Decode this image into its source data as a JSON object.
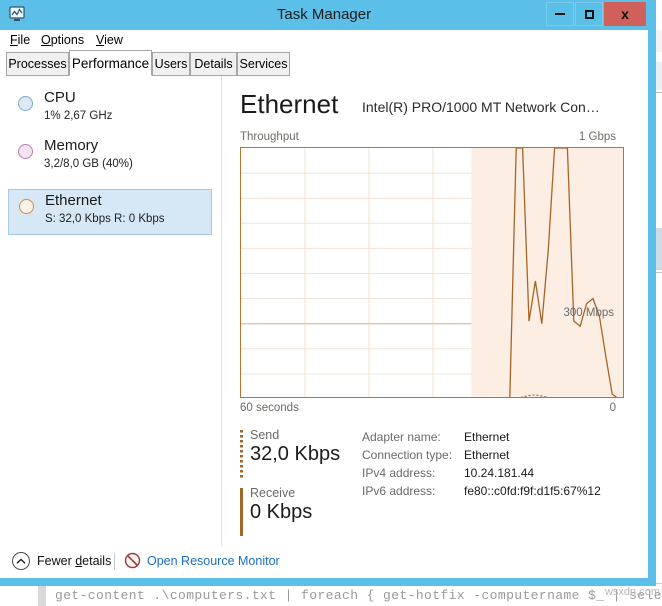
{
  "window": {
    "title": "Task Manager",
    "icon": "task-manager-monitor-icon",
    "controls": {
      "minimize": "–",
      "maximize": "□",
      "close": "x"
    },
    "accent_color": "#5bbfe8",
    "close_color": "#d0605a"
  },
  "menubar": {
    "items": [
      {
        "label": "File",
        "accel": "F"
      },
      {
        "label": "Options",
        "accel": "O"
      },
      {
        "label": "View",
        "accel": "V"
      }
    ]
  },
  "tabs": {
    "active": "Performance",
    "items": [
      {
        "label": "Processes"
      },
      {
        "label": "Performance"
      },
      {
        "label": "Users"
      },
      {
        "label": "Details"
      },
      {
        "label": "Services"
      }
    ]
  },
  "sidebar": {
    "items": [
      {
        "name": "CPU",
        "title": "CPU",
        "subtitle": "1%  2,67 GHz",
        "dot_color": "#dce9f4",
        "dot_border": "#7fa9cd",
        "selected": false
      },
      {
        "name": "Memory",
        "title": "Memory",
        "subtitle": "3,2/8,0 GB (40%)",
        "dot_color": "#f3e2f2",
        "dot_border": "#b57fb2",
        "selected": false
      },
      {
        "name": "Ethernet",
        "title": "Ethernet",
        "subtitle": "S: 32,0 Kbps R: 0 Kbps",
        "dot_color": "#fdf0e4",
        "dot_border": "#c9914c",
        "selected": true
      }
    ]
  },
  "detail": {
    "title": "Ethernet",
    "subtitle": "Intel(R) PRO/1000 MT Network Con…",
    "graph_label_left": "Throughput",
    "graph_label_right": "1 Gbps",
    "graph_mid_label": "300 Mbps",
    "axis_left": "60 seconds",
    "axis_right": "0",
    "line_color": "#a3662a",
    "fill_color": "#fdeee4",
    "grid_color": "#f0e0d0",
    "border_color": "#b5762c"
  },
  "chart_data": {
    "type": "area",
    "title": "Throughput",
    "xlabel": "60 seconds",
    "ylabel": "Throughput",
    "ylim": [
      0,
      1000
    ],
    "ytick_labels": [
      "1 Gbps",
      "300 Mbps",
      "0"
    ],
    "xlim": [
      0,
      60
    ],
    "grid": true,
    "unit": "Mbps",
    "series": [
      {
        "name": "Send",
        "style": "dotted",
        "x": [
          0,
          5,
          10,
          15,
          20,
          25,
          30,
          35,
          40,
          41,
          42,
          43,
          44,
          45,
          46,
          47,
          48,
          49,
          50,
          51,
          52,
          53,
          54,
          55,
          56,
          57,
          58,
          59,
          60
        ],
        "values": [
          0,
          0,
          0,
          0,
          0,
          0,
          0,
          0,
          0,
          0,
          0,
          0,
          8,
          14,
          16,
          12,
          6,
          0,
          0,
          5,
          5,
          5,
          5,
          5,
          5,
          0,
          0,
          0,
          0
        ]
      },
      {
        "name": "Receive",
        "style": "solid",
        "x": [
          0,
          5,
          10,
          15,
          20,
          25,
          30,
          35,
          38,
          40,
          41,
          42,
          43,
          44,
          45,
          46,
          47,
          48,
          49,
          50,
          51,
          52,
          53,
          54,
          55,
          56,
          57,
          58,
          59,
          60
        ],
        "values": [
          0,
          0,
          0,
          0,
          0,
          0,
          0,
          0,
          0,
          0,
          0,
          5,
          1000,
          1000,
          310,
          470,
          300,
          590,
          1000,
          1000,
          1000,
          310,
          290,
          380,
          400,
          330,
          170,
          20,
          0,
          0
        ]
      }
    ],
    "highlight_region": {
      "from": 36,
      "to": 60,
      "fill": "#fdeee4"
    }
  },
  "stats": {
    "send": {
      "label": "Send",
      "value": "32,0 Kbps",
      "indicator": "dotted"
    },
    "receive": {
      "label": "Receive",
      "value": "0 Kbps",
      "indicator": "solid"
    },
    "adapter": [
      {
        "key": "Adapter name:",
        "value": "Ethernet"
      },
      {
        "key": "Connection type:",
        "value": "Ethernet"
      },
      {
        "key": "IPv4 address:",
        "value": "10.24.181.44"
      },
      {
        "key": "IPv6 address:",
        "value": "fe80::c0fd:f9f:d1f5:67%12"
      }
    ]
  },
  "footer": {
    "fewer_details": {
      "label_pre": "Fewer ",
      "accel": "d",
      "label_post": "etails"
    },
    "open_resource_monitor": "Open Resource Monitor",
    "link_color": "#1a6fc4"
  },
  "background": {
    "console_text": "get-content .\\computers.txt | foreach { get-hotfix -computername $_ | select-",
    "watermark": "wsxdn.com"
  }
}
